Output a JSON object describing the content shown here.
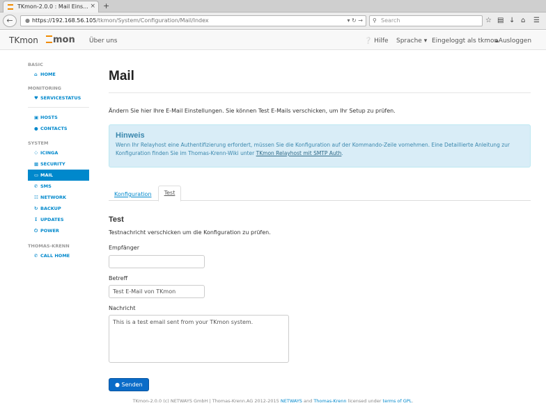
{
  "browser": {
    "tab_title": "TKmon-2.0.0 : Mail Eins...",
    "tab_close": "×",
    "new_tab": "+",
    "url_host": "https://192.168.56.105",
    "url_path": "/tkmon/System/Configuration/Mail/Index",
    "search_placeholder": "Search"
  },
  "app": {
    "brand": "TKmon",
    "logo_text": "mon",
    "about": "Über uns",
    "help": "Hilfe",
    "language": "Sprache",
    "logged_in": "Eingeloggt als tkmon",
    "logout": "Ausloggen"
  },
  "sidebar": {
    "sections": [
      {
        "header": "BASIC",
        "items": [
          {
            "label": "HOME",
            "icon": "home-icon"
          }
        ]
      },
      {
        "header": "MONITORING",
        "items": [
          {
            "label": "SERVICESTATUS",
            "icon": "heart-icon"
          }
        ]
      },
      {
        "header": "",
        "items": [
          {
            "label": "HOSTS",
            "icon": "monitor-icon"
          },
          {
            "label": "CONTACTS",
            "icon": "user-icon"
          }
        ]
      },
      {
        "header": "SYSTEM",
        "items": [
          {
            "label": "ICINGA",
            "icon": "spinner-icon"
          },
          {
            "label": "SECURITY",
            "icon": "lock-icon"
          },
          {
            "label": "MAIL",
            "icon": "inbox-icon"
          },
          {
            "label": "SMS",
            "icon": "phone-icon"
          },
          {
            "label": "NETWORK",
            "icon": "sitemap-icon"
          },
          {
            "label": "BACKUP",
            "icon": "refresh-icon"
          },
          {
            "label": "UPDATES",
            "icon": "download-icon"
          },
          {
            "label": "POWER",
            "icon": "power-icon"
          }
        ]
      },
      {
        "header": "THOMAS-KRENN",
        "items": [
          {
            "label": "CALL HOME",
            "icon": "phone-icon"
          }
        ]
      }
    ],
    "active": "MAIL"
  },
  "main": {
    "title": "Mail",
    "intro": "Ändern Sie hier Ihre E-Mail Einstellungen. Sie können Test E-Mails verschicken, um Ihr Setup zu prüfen.",
    "alert": {
      "title": "Hinweis",
      "text": "Wenn Ihr Relayhost eine Authentifizierung erfordert, müssen Sie die Konfiguration auf der Kommando-Zeile vornehmen. Eine Detaillierte Anleitung zur Konfiguration finden Sie im Thomas-Krenn-Wiki unter ",
      "link": "TKmon Relayhost mit SMTP Auth",
      "end": "."
    },
    "tabs": [
      {
        "label": "Konfiguration"
      },
      {
        "label": "Test"
      }
    ],
    "active_tab": "Test",
    "test": {
      "heading": "Test",
      "subtitle": "Testnachricht verschicken um die Konfiguration zu prüfen.",
      "recipient_label": "Empfänger",
      "recipient_value": "",
      "subject_label": "Betreff",
      "subject_value": "Test E-Mail von TKmon",
      "message_label": "Nachricht",
      "message_value": "This is a test email sent from your TKmon system.",
      "send_label": "Senden"
    }
  },
  "footer": {
    "text1": "TKmon-2.0.0 (c) NETWAYS GmbH | Thomas-Krenn.AG 2012-2015 ",
    "netways": "NETWAYS",
    "and": " and ",
    "thomaskrenn": "Thomas-Krenn",
    "licensed": " licensed under ",
    "gpl": "terms of GPL",
    "end": "."
  },
  "colors": {
    "accent": "#0088cc",
    "alert_bg": "#d9edf7",
    "alert_text": "#3a87ad",
    "button": "#0a6cc8",
    "logo": "#f08a00"
  }
}
